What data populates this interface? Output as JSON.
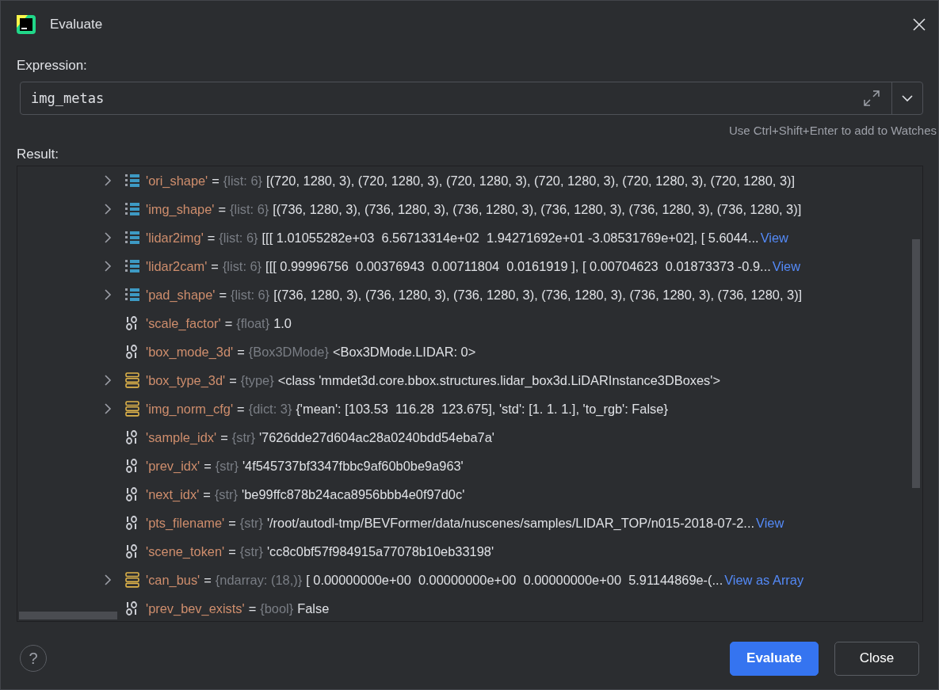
{
  "window": {
    "title": "Evaluate"
  },
  "expression": {
    "label": "Expression:",
    "value": "img_metas",
    "hint": "Use Ctrl+Shift+Enter to add to Watches"
  },
  "result": {
    "label": "Result:",
    "separator": "=",
    "rows": [
      {
        "expandable": true,
        "kind": "list",
        "name": "'ori_shape'",
        "type": "{list: 6}",
        "value": "[(720, 1280, 3), (720, 1280, 3), (720, 1280, 3), (720, 1280, 3), (720, 1280, 3), (720, 1280, 3)]"
      },
      {
        "expandable": true,
        "kind": "list",
        "name": "'img_shape'",
        "type": "{list: 6}",
        "value": "[(736, 1280, 3), (736, 1280, 3), (736, 1280, 3), (736, 1280, 3), (736, 1280, 3), (736, 1280, 3)]"
      },
      {
        "expandable": true,
        "kind": "list",
        "name": "'lidar2img'",
        "type": "{list: 6}",
        "value": "[[[ 1.01055282e+03  6.56713314e+02  1.94271692e+01 -3.08531769e+02], [ 5.6044...",
        "link": "View"
      },
      {
        "expandable": true,
        "kind": "list",
        "name": "'lidar2cam'",
        "type": "{list: 6}",
        "value": "[[[ 0.99996756  0.00376943  0.00711804  0.0161919 ], [ 0.00704623  0.01873373 -0.9...",
        "link": "View"
      },
      {
        "expandable": true,
        "kind": "list",
        "name": "'pad_shape'",
        "type": "{list: 6}",
        "value": "[(736, 1280, 3), (736, 1280, 3), (736, 1280, 3), (736, 1280, 3), (736, 1280, 3), (736, 1280, 3)]"
      },
      {
        "expandable": false,
        "kind": "scalar",
        "name": "'scale_factor'",
        "type": "{float}",
        "value": "1.0"
      },
      {
        "expandable": false,
        "kind": "scalar",
        "name": "'box_mode_3d'",
        "type": "{Box3DMode}",
        "value": "<Box3DMode.LIDAR: 0>"
      },
      {
        "expandable": true,
        "kind": "object",
        "name": "'box_type_3d'",
        "type": "{type}",
        "value": "<class 'mmdet3d.core.bbox.structures.lidar_box3d.LiDARInstance3DBoxes'>"
      },
      {
        "expandable": true,
        "kind": "object",
        "name": "'img_norm_cfg'",
        "type": "{dict: 3}",
        "value": "{'mean': [103.53  116.28  123.675], 'std': [1. 1. 1.], 'to_rgb': False}"
      },
      {
        "expandable": false,
        "kind": "scalar",
        "name": "'sample_idx'",
        "type": "{str}",
        "value": "'7626dde27d604ac28a0240bdd54eba7a'"
      },
      {
        "expandable": false,
        "kind": "scalar",
        "name": "'prev_idx'",
        "type": "{str}",
        "value": "'4f545737bf3347fbbc9af60b0be9a963'"
      },
      {
        "expandable": false,
        "kind": "scalar",
        "name": "'next_idx'",
        "type": "{str}",
        "value": "'be99ffc878b24aca8956bbb4e0f97d0c'"
      },
      {
        "expandable": false,
        "kind": "scalar",
        "name": "'pts_filename'",
        "type": "{str}",
        "value": "'/root/autodl-tmp/BEVFormer/data/nuscenes/samples/LIDAR_TOP/n015-2018-07-2...",
        "link": "View"
      },
      {
        "expandable": false,
        "kind": "scalar",
        "name": "'scene_token'",
        "type": "{str}",
        "value": "'cc8c0bf57f984915a77078b10eb33198'"
      },
      {
        "expandable": true,
        "kind": "object",
        "name": "'can_bus'",
        "type": "{ndarray: (18,)}",
        "value": "[ 0.00000000e+00  0.00000000e+00  0.00000000e+00  5.91144869e-(...",
        "link": "View as Array"
      },
      {
        "expandable": false,
        "kind": "scalar",
        "name": "'prev_bev_exists'",
        "type": "{bool}",
        "value": "False"
      }
    ]
  },
  "help": {
    "label": "?"
  },
  "buttons": [
    {
      "label": "Evaluate",
      "primary": true
    },
    {
      "label": "Close",
      "primary": false
    }
  ]
}
